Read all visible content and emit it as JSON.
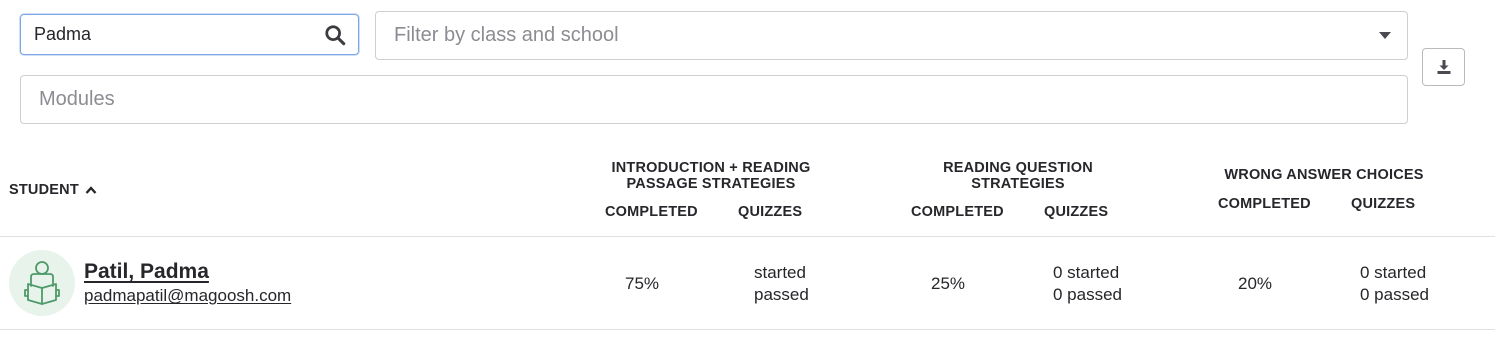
{
  "filters": {
    "search_value": "Padma",
    "class_school_placeholder": "Filter by class and school",
    "modules_placeholder": "Modules"
  },
  "icons": {
    "search": "search-icon",
    "dropdown": "caret-down-icon",
    "download": "download-icon",
    "sort": "chevron-up-icon",
    "avatar": "student-reading-icon"
  },
  "table": {
    "student_header": "STUDENT",
    "groups": [
      {
        "title_line1": "INTRODUCTION + READING",
        "title_line2": "PASSAGE STRATEGIES",
        "completed_label": "COMPLETED",
        "quizzes_label": "QUIZZES"
      },
      {
        "title_line1": "READING QUESTION",
        "title_line2": "STRATEGIES",
        "completed_label": "COMPLETED",
        "quizzes_label": "QUIZZES"
      },
      {
        "title_line1": "WRONG ANSWER CHOICES",
        "title_line2": "",
        "completed_label": "COMPLETED",
        "quizzes_label": "QUIZZES"
      }
    ],
    "rows": [
      {
        "name": "Patil, Padma",
        "email": "padmapatil@magoosh.com",
        "cells": [
          {
            "completed": "75%",
            "quizzes_started": "started",
            "quizzes_passed": "passed"
          },
          {
            "completed": "25%",
            "quizzes_started": "0 started",
            "quizzes_passed": "0 passed"
          },
          {
            "completed": "20%",
            "quizzes_started": "0 started",
            "quizzes_passed": "0 passed"
          }
        ]
      }
    ]
  },
  "colors": {
    "focus_border": "#7aa7e6",
    "avatar_bg": "#e8f3ec",
    "avatar_icon": "#4f9a6a"
  }
}
